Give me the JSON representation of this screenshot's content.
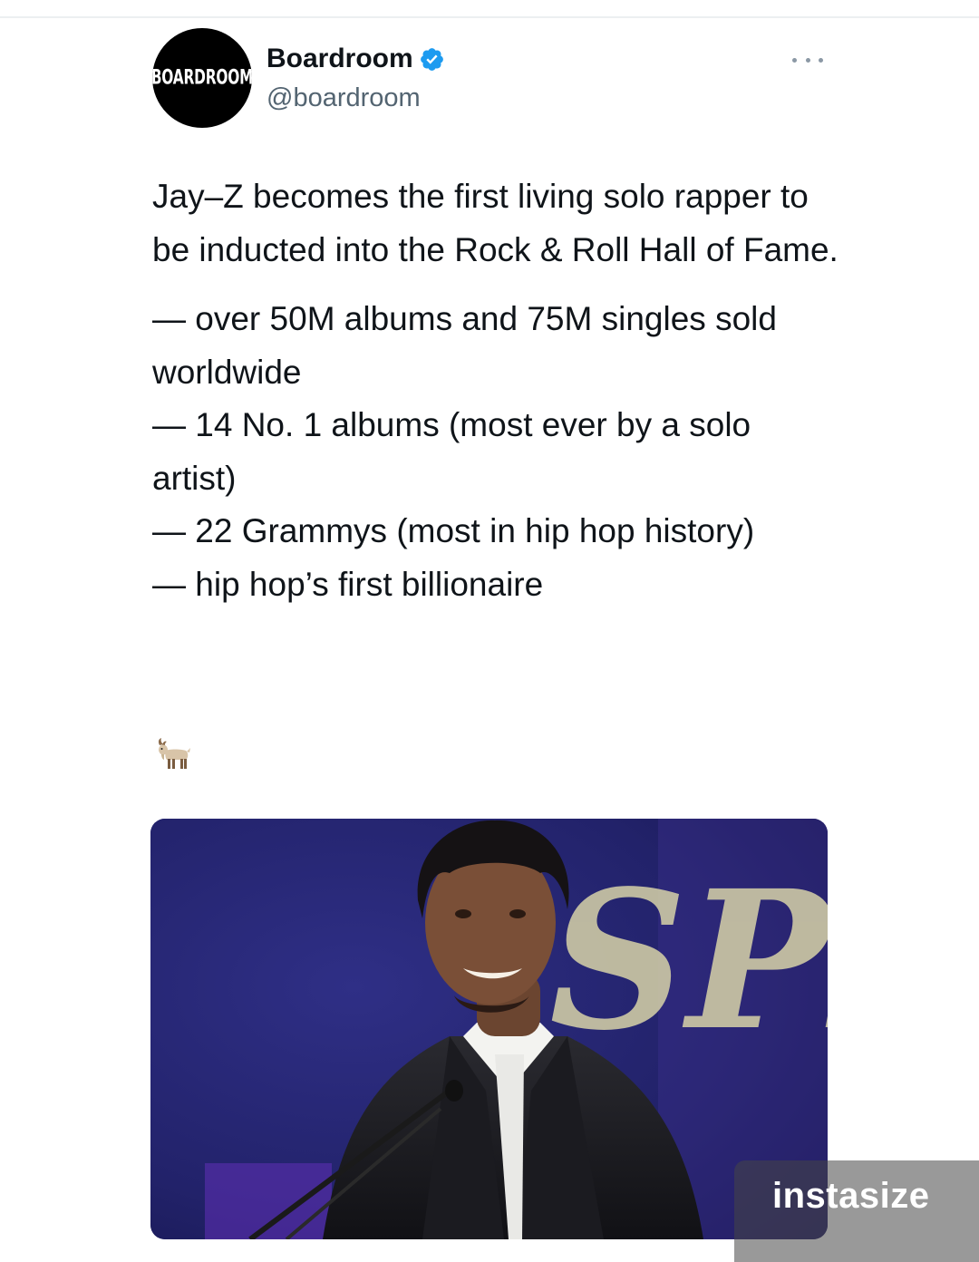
{
  "account": {
    "avatar_text": "BOARDROOM",
    "display_name": "Boardroom",
    "handle": "@boardroom",
    "verified": true,
    "verified_color": "#1d9bf0"
  },
  "tweet": {
    "intro": "Jay–Z becomes the first living solo rapper to be inducted into the Rock & Roll Hall of Fame.",
    "bullets": [
      "— over 50M albums and 75M singles sold worldwide",
      "— 14 No. 1 albums (most ever by a solo artist)",
      "— 22 Grammys (most in hip hop history)",
      "— hip hop’s first billionaire"
    ],
    "emoji": "🐐"
  },
  "media": {
    "stage_sign_text": "SPI"
  },
  "watermark": {
    "text": "instasize"
  },
  "icons": {
    "more": "more-icon",
    "verified": "verified-badge-icon",
    "emoji": "goat-icon"
  }
}
